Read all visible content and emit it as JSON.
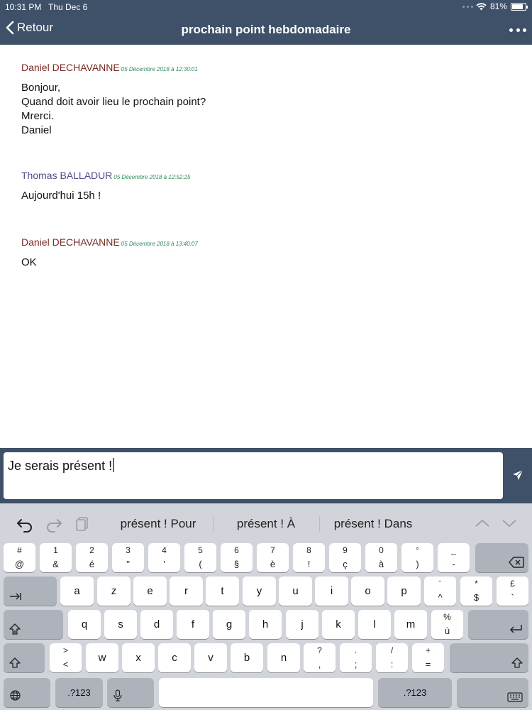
{
  "status": {
    "time": "10:31 PM",
    "date": "Thu Dec 6",
    "battery": "81%",
    "battery_level": 0.81
  },
  "nav": {
    "back_label": "Retour",
    "title": "prochain point hebdomadaire"
  },
  "messages": [
    {
      "author": "Daniel DECHAVANNE",
      "timestamp": "05 Décembre 2018 à 12:30:01",
      "lines": [
        "Bonjour,",
        "Quand doit avoir lieu le prochain point?",
        "Mrerci.",
        "Daniel"
      ]
    },
    {
      "author": "Thomas BALLADUR",
      "timestamp": "05 Décembre 2018 à 12:52:25",
      "lines": [
        "Aujourd'hui 15h !"
      ]
    },
    {
      "author": "Daniel DECHAVANNE",
      "timestamp": "05 Décembre 2018 à 13:40:07",
      "lines": [
        "OK"
      ]
    }
  ],
  "composer": {
    "value": "Je serais présent !"
  },
  "keyboard": {
    "suggestions": [
      "présent ! Pour",
      "présent ! À",
      "présent ! Dans"
    ],
    "row1": [
      {
        "top": "#",
        "bot": "@"
      },
      {
        "top": "1",
        "bot": "&"
      },
      {
        "top": "2",
        "bot": "é"
      },
      {
        "top": "3",
        "bot": "\""
      },
      {
        "top": "4",
        "bot": "'"
      },
      {
        "top": "5",
        "bot": "("
      },
      {
        "top": "6",
        "bot": "§"
      },
      {
        "top": "7",
        "bot": "è"
      },
      {
        "top": "8",
        "bot": "!"
      },
      {
        "top": "9",
        "bot": "ç"
      },
      {
        "top": "0",
        "bot": "à"
      },
      {
        "top": "°",
        "bot": ")"
      },
      {
        "top": "_",
        "bot": "-"
      }
    ],
    "row2": [
      "a",
      "z",
      "e",
      "r",
      "t",
      "y",
      "u",
      "i",
      "o",
      "p"
    ],
    "row2_extra": [
      {
        "top": "¨",
        "bot": "^"
      },
      {
        "top": "*",
        "bot": "$"
      },
      {
        "top": "£",
        "bot": "`"
      }
    ],
    "row3": [
      "q",
      "s",
      "d",
      "f",
      "g",
      "h",
      "j",
      "k",
      "l",
      "m"
    ],
    "row3_extra": {
      "top": "%",
      "bot": "ù"
    },
    "row4_first": {
      "top": ">",
      "bot": "<"
    },
    "row4": [
      "w",
      "x",
      "c",
      "v",
      "b",
      "n"
    ],
    "row4_extra": [
      {
        "top": "?",
        "bot": ","
      },
      {
        "top": ".",
        "bot": ";"
      },
      {
        "top": "/",
        "bot": ":"
      },
      {
        "top": "+",
        "bot": "="
      }
    ],
    "numbers_label": ".?123"
  }
}
